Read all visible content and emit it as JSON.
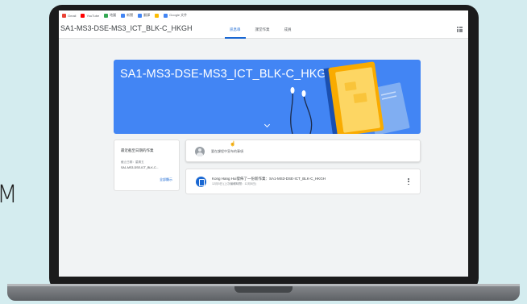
{
  "bookmarks": [
    {
      "label": "Gmail",
      "icon": "gmail-icon",
      "color": "#ea4335"
    },
    {
      "label": "YouTube",
      "icon": "youtube-icon",
      "color": "#ff0000"
    },
    {
      "label": "地圖",
      "icon": "maps-icon",
      "color": "#34a853"
    },
    {
      "label": "新聞",
      "icon": "news-icon",
      "color": "#4285f4"
    },
    {
      "label": "翻譯",
      "icon": "translate-icon",
      "color": "#4285f4"
    },
    {
      "label": "",
      "icon": "drive-icon",
      "color": "#fbbc04"
    },
    {
      "label": "Google 文件",
      "icon": "docs-icon",
      "color": "#4285f4"
    }
  ],
  "header": {
    "class_name": "SA1-MS3-DSE-MS3_ICT_BLK-C_HKGH",
    "tabs": [
      {
        "label": "訊息串",
        "active": true
      },
      {
        "label": "課堂作業",
        "active": false
      },
      {
        "label": "成員",
        "active": false
      }
    ]
  },
  "banner": {
    "title": "SA1-MS3-DSE-MS3_ICT_BLK-C_HKGH",
    "color": "#4285f4"
  },
  "upcoming": {
    "title": "最近截至日期的作業",
    "due": "截止日期：星期五",
    "item": "SA1-MS3-DSE-ICT_BLK-C...",
    "view_all": "全部顯示"
  },
  "announce": {
    "placeholder": "要在課程中宣布的事項"
  },
  "post": {
    "title": "Kong Hang Hui發佈了一份新作業：SA1-MS3-DSE-ICT_BLK-C_HKGH",
    "date": "12月5日 (上次編輯時間：12月5日)"
  },
  "colors": {
    "accent": "#1967d2",
    "page_bg": "#d4ecef"
  },
  "edge_text": "M"
}
